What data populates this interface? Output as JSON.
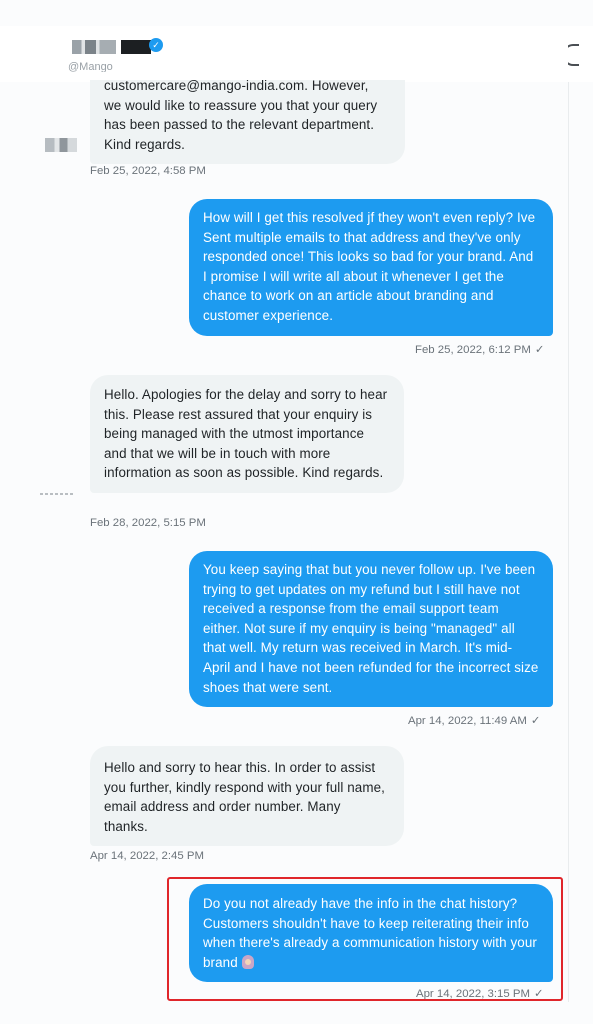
{
  "header": {
    "verified_mark": "✓",
    "handle": "@Mango"
  },
  "messages": [
    {
      "direction": "incoming",
      "text": "customercare@mango-india.com. However, we would like to reassure you that your query has been passed to the relevant department. Kind regards.",
      "timestamp": "Feb 25, 2022, 4:58 PM"
    },
    {
      "direction": "outgoing",
      "text": "How will I get this resolved jf they won't even reply? Ive Sent multiple emails to that address and they've only responded once! This looks so bad for your brand. And I promise I will write all about it whenever I get the chance to work on an article about branding and customer experience.",
      "timestamp": "Feb 25, 2022, 6:12 PM"
    },
    {
      "direction": "incoming",
      "text": "Hello. Apologies for the delay and sorry to hear this. Please rest assured that your enquiry is being managed with the utmost importance and that we will be in touch with more information as soon as possible. Kind regards.",
      "timestamp": "Feb 28, 2022, 5:15 PM"
    },
    {
      "direction": "outgoing",
      "text": "You keep saying that but you never follow up. I've been trying to get updates on my refund but I still have not received a response from the email support team either. Not sure if my enquiry is being \"managed\" all that well. My return was received in March. It's mid-April and I have not been refunded for the incorrect size shoes that were sent.",
      "timestamp": "Apr 14, 2022, 11:49 AM"
    },
    {
      "direction": "incoming",
      "text": "Hello and sorry to hear this. In order to assist you further, kindly respond with your full name, email address and order number. Many thanks.",
      "timestamp": "Apr 14, 2022, 2:45 PM"
    },
    {
      "direction": "outgoing",
      "text": "Do you not already have the info in the chat history? Customers shouldn't have to keep reiterating their info when there's already a communication history with your brand",
      "timestamp": "Apr 14, 2022, 3:15 PM"
    }
  ],
  "read_mark": "✓",
  "colors": {
    "outgoing_bubble": "#1d9bf0",
    "incoming_bubble": "#eff3f4",
    "highlight_box": "#e0262b"
  },
  "icons": [
    "verified-badge-icon",
    "info-icon",
    "read-check-icon",
    "woman-emoji-icon"
  ]
}
